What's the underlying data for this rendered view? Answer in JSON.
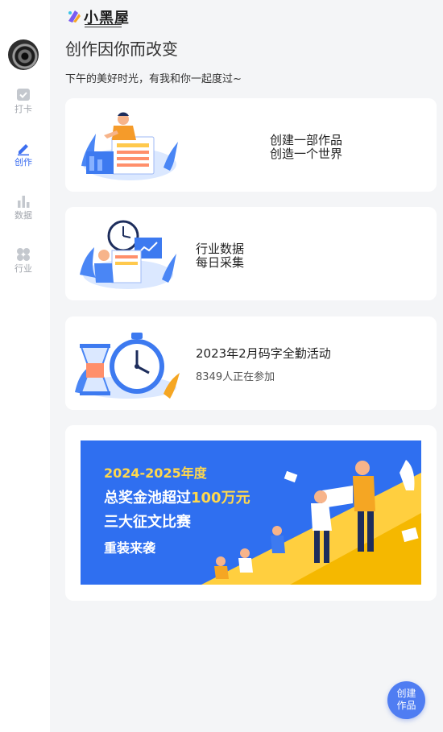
{
  "brand": {
    "name": "小黑屋"
  },
  "sidebar": {
    "items": [
      {
        "label": "打卡",
        "icon": "checkin-icon"
      },
      {
        "label": "创作",
        "icon": "pencil-icon",
        "active": true
      },
      {
        "label": "数据",
        "icon": "bar-chart-icon"
      },
      {
        "label": "行业",
        "icon": "clover-icon"
      }
    ]
  },
  "header": {
    "title": "创作因你而改变",
    "subtitle": "下午的美好时光，有我和你一起度过~"
  },
  "cards": [
    {
      "line1": "创建一部作品",
      "line2": "创造一个世界",
      "illustration": "writer-at-desk-illustration"
    },
    {
      "line1": "行业数据",
      "line2": "每日采集",
      "illustration": "analyst-with-clock-illustration"
    },
    {
      "title": "2023年2月码字全勤活动",
      "participants": "8349人正在参加",
      "illustration": "stopwatch-hourglass-illustration"
    }
  ],
  "banner": {
    "line1": "2024-2025年度",
    "line2_prefix": "总奖金池超过",
    "line2_highlight": "100万元",
    "line3": "三大征文比赛",
    "line4": "重装来袭"
  },
  "fab": {
    "line1": "创建",
    "line2": "作品"
  },
  "colors": {
    "accent": "#3c6ef0",
    "banner_bg": "#2f6ff0",
    "banner_highlight": "#ffd84d",
    "inactive": "#a2a6ad"
  }
}
